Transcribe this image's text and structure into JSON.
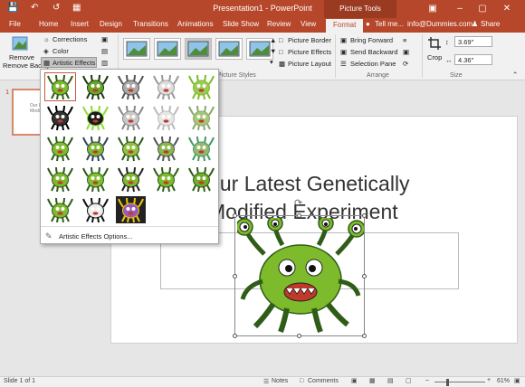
{
  "window": {
    "title": "Presentation1 - PowerPoint",
    "context_tab": "Picture Tools",
    "tell_me": "Tell me...",
    "account": "info@Dummies.com",
    "share": "Share"
  },
  "tabs": [
    "File",
    "Home",
    "Insert",
    "Design",
    "Transitions",
    "Animations",
    "Slide Show",
    "Review",
    "View",
    "Format"
  ],
  "active_tab": "Format",
  "ribbon": {
    "remove_background": "Remove Background",
    "corrections": "Corrections",
    "color": "Color",
    "artistic_effects": "Artistic Effects",
    "picture_border": "Picture Border",
    "picture_effects": "Picture Effects",
    "picture_layout": "Picture Layout",
    "picture_styles_group": "Picture Styles",
    "bring_forward": "Bring Forward",
    "send_backward": "Send Backward",
    "selection_pane": "Selection Pane",
    "arrange_group": "Arrange",
    "crop": "Crop",
    "height": "3.69\"",
    "width": "4.36\"",
    "size_group": "Size"
  },
  "dropdown": {
    "options_label": "Artistic Effects Options...",
    "effects_count": 23,
    "selected_index": 0
  },
  "thumbnail": {
    "number": "1"
  },
  "slide": {
    "title_line1": "Our Latest Genetically",
    "title_line2": "Modified Experiment"
  },
  "statusbar": {
    "slide": "Slide 1 of 1",
    "notes": "Notes",
    "comments": "Comments",
    "zoom": "61%"
  },
  "colors": {
    "accent": "#b7472a",
    "monster_green": "#7dbb2c"
  }
}
